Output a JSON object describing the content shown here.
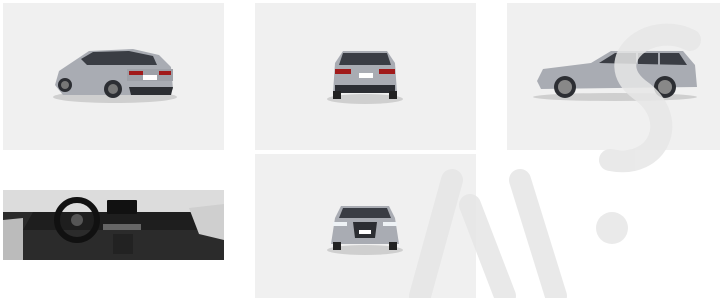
{
  "gallery": {
    "images": [
      {
        "name": "rear-three-quarter-view"
      },
      {
        "name": "rear-view"
      },
      {
        "name": "side-profile-view"
      },
      {
        "name": "interior-dashboard-view"
      },
      {
        "name": "front-view"
      }
    ]
  },
  "colors": {
    "tile_background": "#f0f0f0",
    "car_body": "#a9acb3",
    "watermark": "#e6e6e6"
  }
}
